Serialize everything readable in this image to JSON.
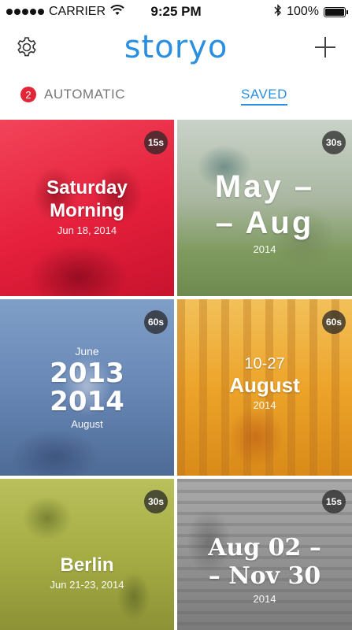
{
  "status_bar": {
    "carrier": "CARRIER",
    "time": "9:25 PM",
    "battery": "100%"
  },
  "header": {
    "logo": "storyo",
    "settings_icon": "gear-icon",
    "add_icon": "plus-icon"
  },
  "tabs": {
    "automatic": {
      "badge": "2",
      "label": "AUTOMATIC"
    },
    "saved": {
      "label": "SAVED",
      "active": true
    }
  },
  "colors": {
    "accent": "#2a8fe0",
    "badge": "#e32636"
  },
  "stories": [
    {
      "pre": "",
      "title_line1": "Saturday",
      "title_line2": "Morning",
      "sub": "Jun 18, 2014",
      "duration": "15s",
      "tint": "#e8253f"
    },
    {
      "pre": "",
      "title_line1": "May –",
      "title_line2": "– Aug",
      "sub": "2014",
      "duration": "30s",
      "tint": "#8aa27a"
    },
    {
      "pre": "June",
      "title_line1": "2013",
      "title_line2": "2014",
      "sub": "August",
      "duration": "60s",
      "tint": "#5f86b8"
    },
    {
      "pre": "10-27",
      "title_line1": "August",
      "title_line2": "",
      "sub": "2014",
      "duration": "60s",
      "tint": "#f0a61c"
    },
    {
      "pre": "",
      "title_line1": "Berlin",
      "title_line2": "",
      "sub": "Jun 21-23, 2014",
      "duration": "30s",
      "tint": "#a8b04a"
    },
    {
      "pre": "",
      "title_line1": "Aug 02 –",
      "title_line2": "– Nov 30",
      "sub": "2014",
      "duration": "15s",
      "tint": "#8a8a8a"
    }
  ]
}
